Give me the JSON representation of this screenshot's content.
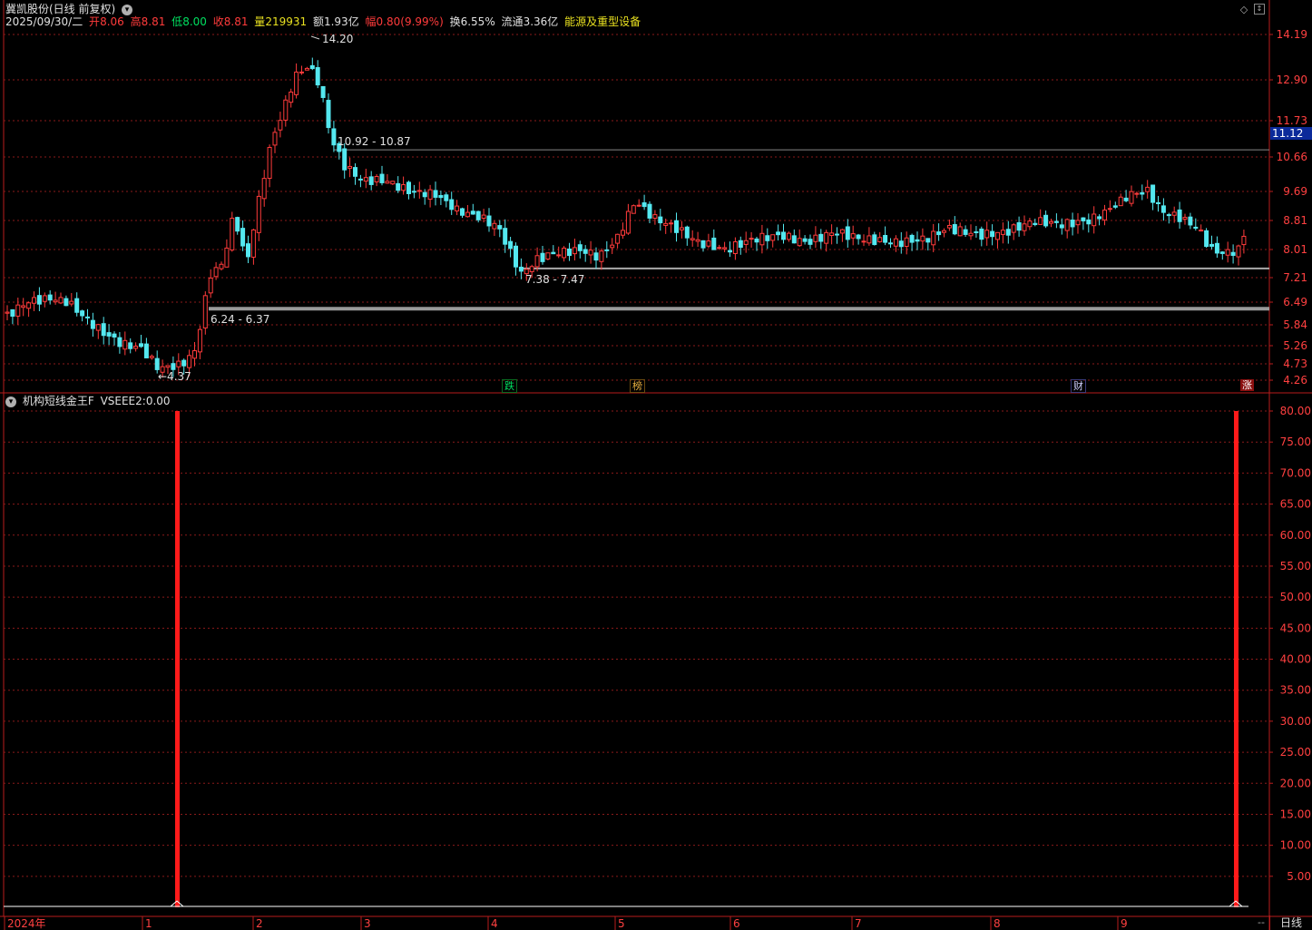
{
  "header": {
    "stock_name": "冀凯股份(日线 前复权)",
    "date": "2025/09/30/二",
    "open_label": "开",
    "open": "8.06",
    "high_label": "高",
    "high": "8.81",
    "low_label": "低",
    "low": "8.00",
    "close_label": "收",
    "close": "8.81",
    "volume_label": "量",
    "volume": "219931",
    "amount_label": "额",
    "amount": "1.93亿",
    "change_label": "幅",
    "change": "0.80(9.99%)",
    "turnover_label": "换",
    "turnover": "6.55%",
    "float_label": "流通",
    "float": "3.36亿",
    "sector": "能源及重型设备"
  },
  "indicator": {
    "label": "机构短线金王F",
    "series_label": "VSEEE2:",
    "series_value": "0.00"
  },
  "price_axis": [
    "14.19",
    "12.90",
    "11.73",
    "10.66",
    "9.69",
    "8.81",
    "8.01",
    "7.21",
    "6.49",
    "5.84",
    "5.26",
    "4.73",
    "4.26"
  ],
  "price_current": "11.12",
  "indicator_axis": [
    "80.00",
    "75.00",
    "70.00",
    "65.00",
    "60.00",
    "55.00",
    "50.00",
    "45.00",
    "40.00",
    "35.00",
    "30.00",
    "25.00",
    "20.00",
    "15.00",
    "10.00",
    "5.00"
  ],
  "time_axis": [
    "2024年",
    "1",
    "2",
    "3",
    "4",
    "5",
    "6",
    "7",
    "8",
    "9"
  ],
  "annotations": {
    "high": "14.20",
    "low": "4.37",
    "zone1": "10.92 - 10.87",
    "zone2": "7.38 - 7.47",
    "zone3": "6.24 - 6.37"
  },
  "event_tags": [
    "跌",
    "榜",
    "财",
    "涨"
  ],
  "period_button": "日线",
  "more_button": "--",
  "colors": {
    "up": "#ff3b3b",
    "down": "#54e8f0",
    "grid": "#8b1a1a",
    "border": "#b71c1c"
  },
  "chart_data": {
    "type": "candlestick",
    "price_ylim": [
      4.26,
      14.19
    ],
    "indicator_ylim": [
      0,
      80
    ],
    "indicator_spikes": [
      {
        "month_position": "1",
        "value": 80
      },
      {
        "month_position": "9",
        "value": 80
      }
    ],
    "key_levels": [
      10.87,
      7.47,
      6.3
    ]
  }
}
